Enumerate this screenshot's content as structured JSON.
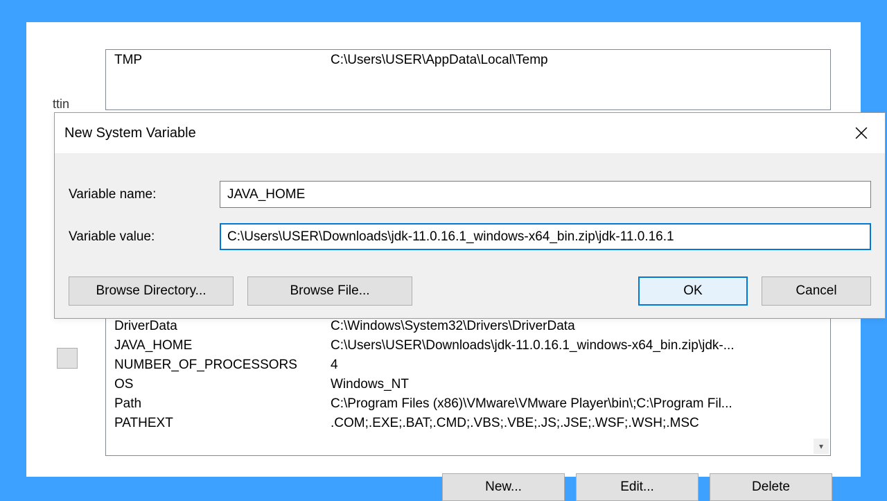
{
  "bg": {
    "left_frag": "ttin",
    "upper_row": {
      "var": "TMP",
      "val": "C:\\Users\\USER\\AppData\\Local\\Temp"
    },
    "lower_rows": [
      {
        "var": "DriverData",
        "val": "C:\\Windows\\System32\\Drivers\\DriverData"
      },
      {
        "var": "JAVA_HOME",
        "val": "C:\\Users\\USER\\Downloads\\jdk-11.0.16.1_windows-x64_bin.zip\\jdk-..."
      },
      {
        "var": "NUMBER_OF_PROCESSORS",
        "val": "4"
      },
      {
        "var": "OS",
        "val": "Windows_NT"
      },
      {
        "var": "Path",
        "val": "C:\\Program Files (x86)\\VMware\\VMware Player\\bin\\;C:\\Program Fil..."
      },
      {
        "var": "PATHEXT",
        "val": ".COM;.EXE;.BAT;.CMD;.VBS;.VBE;.JS;.JSE;.WSF;.WSH;.MSC"
      }
    ],
    "buttons": {
      "new": "New...",
      "edit": "Edit...",
      "delete": "Delete"
    }
  },
  "dialog": {
    "title": "New System Variable",
    "labels": {
      "name": "Variable name:",
      "value": "Variable value:"
    },
    "values": {
      "name": "JAVA_HOME",
      "value": "C:\\Users\\USER\\Downloads\\jdk-11.0.16.1_windows-x64_bin.zip\\jdk-11.0.16.1"
    },
    "buttons": {
      "browse_dir": "Browse Directory...",
      "browse_file": "Browse File...",
      "ok": "OK",
      "cancel": "Cancel"
    }
  }
}
